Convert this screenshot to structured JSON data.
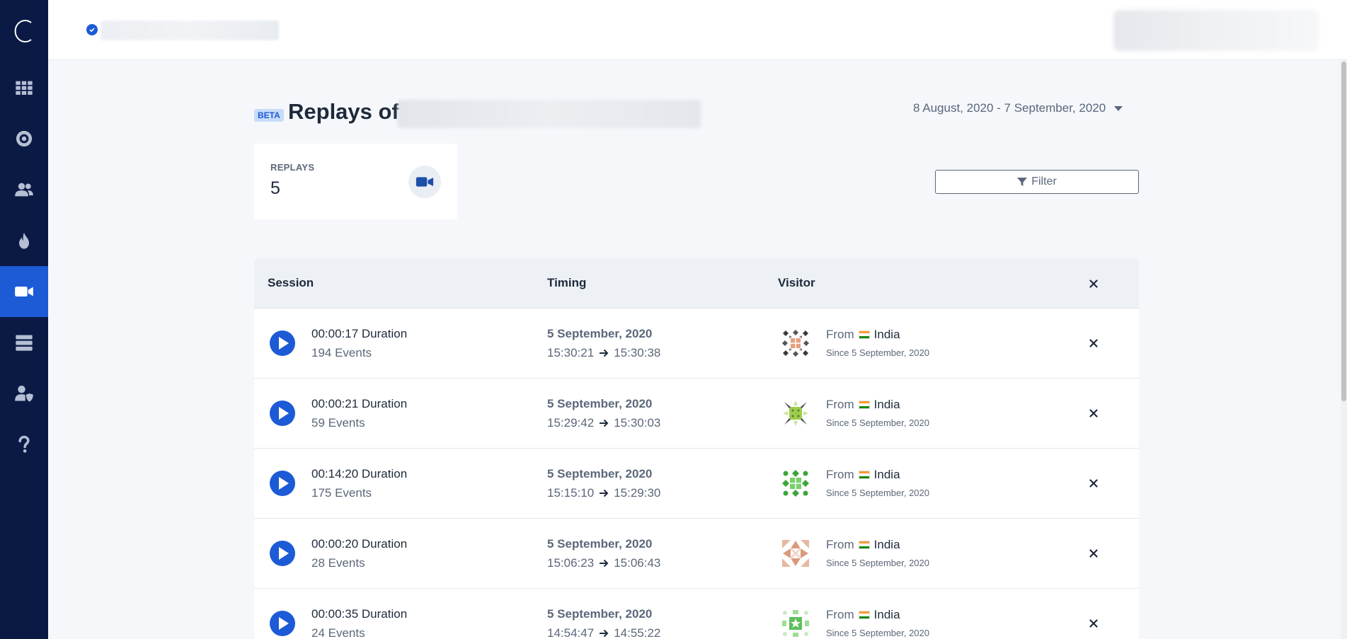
{
  "app": {
    "logo_letter": "C"
  },
  "sidebar": {
    "items": [
      {
        "name": "dashboard",
        "icon": "grid-icon",
        "active": false
      },
      {
        "name": "overview",
        "icon": "target-icon",
        "active": false
      },
      {
        "name": "visitors",
        "icon": "users-icon",
        "active": false
      },
      {
        "name": "heatmaps",
        "icon": "flame-icon",
        "active": false
      },
      {
        "name": "replays",
        "icon": "video-icon",
        "active": true
      },
      {
        "name": "data",
        "icon": "server-icon",
        "active": false
      },
      {
        "name": "privacy",
        "icon": "user-shield-icon",
        "active": false
      },
      {
        "name": "help",
        "icon": "question-icon",
        "active": false
      }
    ]
  },
  "header": {
    "badge": "BETA",
    "title": "Replays of",
    "date_range": "8 August, 2020 - 7 September, 2020"
  },
  "stats": {
    "label": "REPLAYS",
    "value": "5"
  },
  "filter": {
    "label": "Filter"
  },
  "table": {
    "headers": {
      "session": "Session",
      "timing": "Timing",
      "visitor": "Visitor"
    },
    "rows": [
      {
        "duration": "00:00:17 Duration",
        "events": "194 Events",
        "date": "5 September, 2020",
        "start": "15:30:21",
        "end": "15:30:38",
        "from_label": "From",
        "country": "India",
        "since": "Since 5 September, 2020"
      },
      {
        "duration": "00:00:21 Duration",
        "events": "59 Events",
        "date": "5 September, 2020",
        "start": "15:29:42",
        "end": "15:30:03",
        "from_label": "From",
        "country": "India",
        "since": "Since 5 September, 2020"
      },
      {
        "duration": "00:14:20 Duration",
        "events": "175 Events",
        "date": "5 September, 2020",
        "start": "15:15:10",
        "end": "15:29:30",
        "from_label": "From",
        "country": "India",
        "since": "Since 5 September, 2020"
      },
      {
        "duration": "00:00:20 Duration",
        "events": "28 Events",
        "date": "5 September, 2020",
        "start": "15:06:23",
        "end": "15:06:43",
        "from_label": "From",
        "country": "India",
        "since": "Since 5 September, 2020"
      },
      {
        "duration": "00:00:35 Duration",
        "events": "24 Events",
        "date": "5 September, 2020",
        "start": "14:54:47",
        "end": "14:55:22",
        "from_label": "From",
        "country": "India",
        "since": "Since 5 September, 2020"
      }
    ]
  },
  "colors": {
    "sidebar_bg": "#0b1a45",
    "accent": "#1c5ad6",
    "page_bg": "#f5f7fb"
  }
}
